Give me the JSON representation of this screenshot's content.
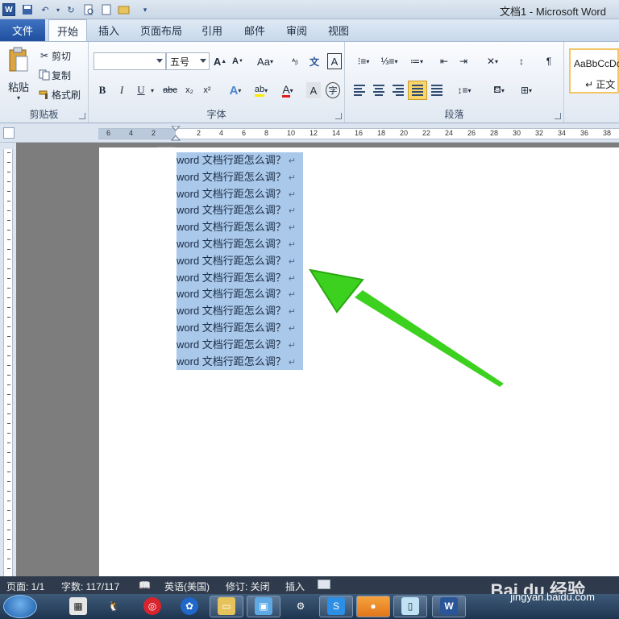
{
  "titlebar": {
    "title": "文档1 - Microsoft Word",
    "quick_access": [
      "save-icon",
      "undo-icon",
      "redo-icon",
      "print-preview-icon",
      "new-icon",
      "open-icon",
      "customize-icon"
    ]
  },
  "tabs": {
    "file": "文件",
    "items": [
      "开始",
      "插入",
      "页面布局",
      "引用",
      "邮件",
      "审阅",
      "视图"
    ],
    "active": "开始"
  },
  "clipboard": {
    "paste": "粘贴",
    "cut": "剪切",
    "copy": "复制",
    "format_painter": "格式刷",
    "label": "剪贴板"
  },
  "font": {
    "name_value": "",
    "size_value": "五号",
    "case_label": "Aa",
    "label": "字体"
  },
  "paragraph": {
    "label": "段落"
  },
  "styles": {
    "sample": "AaBbCcDc",
    "normal": "↵ 正文"
  },
  "ruler": {
    "numbers": [
      "6",
      "4",
      "2",
      "2",
      "4",
      "6",
      "8",
      "10",
      "12",
      "14",
      "16",
      "18",
      "20",
      "22",
      "24",
      "26",
      "28",
      "30",
      "32",
      "34",
      "36",
      "38"
    ]
  },
  "document": {
    "lines": [
      "word 文档行距怎么调？",
      "word 文档行距怎么调？",
      "word 文档行距怎么调？",
      "word 文档行距怎么调？",
      "word 文档行距怎么调？",
      "word 文档行距怎么调？",
      "word 文档行距怎么调？",
      "word 文档行距怎么调？",
      "word 文档行距怎么调？",
      "word 文档行距怎么调？",
      "word 文档行距怎么调？",
      "word 文档行距怎么调？",
      "word 文档行距怎么调？"
    ],
    "paragraph_mark": "↵",
    "selection_color": "#a9c8ea"
  },
  "statusbar": {
    "page": "页面: 1/1",
    "words": "字数: 117/117",
    "language": "英语(美国)",
    "track": "修订: 关闭",
    "insert": "插入",
    "watermark": "Bai du 经验",
    "url": "jingyan.baidu.com"
  },
  "annotation": {
    "arrow_color": "#3cd11e"
  }
}
